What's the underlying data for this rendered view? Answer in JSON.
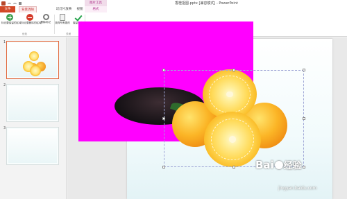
{
  "window": {
    "title": "香橙抠图.pptx [兼容模式] - PowerPoint",
    "contextual_tab_group": "图片工具"
  },
  "tabs": {
    "file": "文件",
    "background_removal": "背景消除",
    "slideshow": "幻灯片放映",
    "view": "视图",
    "format": "格式"
  },
  "ribbon": {
    "mark_keep": "标记要保留的区域",
    "mark_remove": "标记要删除的区域",
    "delete_mark": "删除标记",
    "discard_changes": "放弃所有更改",
    "keep_changes": "保留更改",
    "group_optimize": "优化",
    "group_close": "关闭"
  },
  "slides": [
    {
      "number": "1",
      "selected": true
    },
    {
      "number": "2",
      "selected": false
    },
    {
      "number": "3",
      "selected": false
    }
  ],
  "watermark": {
    "brand_left": "Bai",
    "brand_right": "经验",
    "url": "jingyan.baidu.com"
  },
  "colors": {
    "accent": "#d24726",
    "removal_mask": "#ff00ff",
    "context_tab": "#b1388e"
  }
}
